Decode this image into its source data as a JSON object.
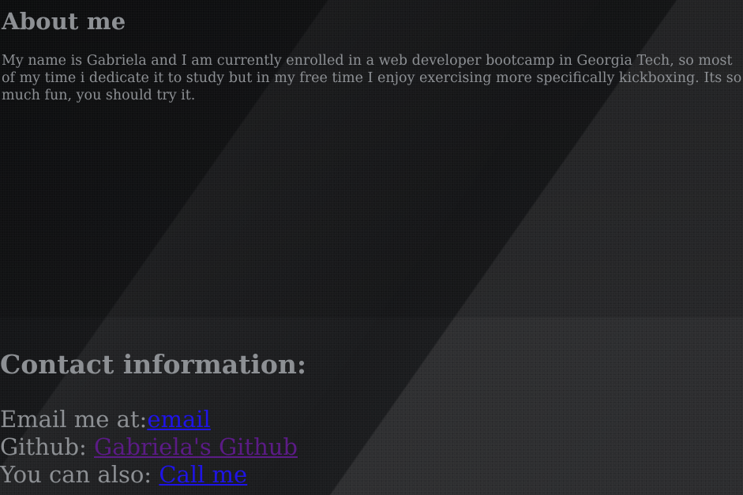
{
  "about": {
    "heading": "About me",
    "paragraph": "My name is Gabriela and I am currently enrolled in a web developer bootcamp in Georgia Tech, so most of my time i dedicate it to study but in my free time I enjoy exercising more specifically kickboxing. Its so much fun, you should try it."
  },
  "contact": {
    "heading": "Contact information:",
    "email_label": "Email me at:",
    "email_link": "email",
    "github_label": "Github: ",
    "github_link": "Gabriela's Github",
    "phone_label": "You can also: ",
    "phone_link": "Call me"
  },
  "colors": {
    "text": "#8d9094",
    "link": "#1f14e8",
    "visited_link": "#5b1b86",
    "background": "#1c1d1f"
  }
}
